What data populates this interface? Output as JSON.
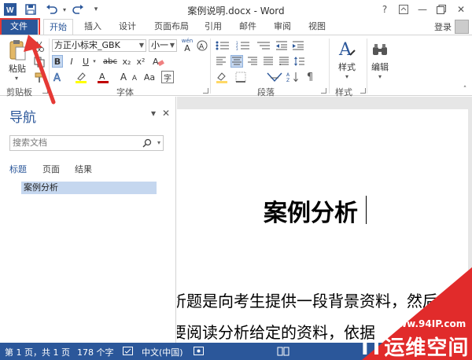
{
  "window": {
    "title": "案例说明.docx - Word",
    "help": "?",
    "minimize": "—",
    "close": "✕"
  },
  "ribbon_tabs": [
    {
      "label": "文件"
    },
    {
      "label": "开始"
    },
    {
      "label": "插入"
    },
    {
      "label": "设计"
    },
    {
      "label": "页面布局"
    },
    {
      "label": "引用"
    },
    {
      "label": "邮件"
    },
    {
      "label": "审阅"
    },
    {
      "label": "视图"
    }
  ],
  "account": {
    "login": "登录"
  },
  "ribbon": {
    "paste": "粘贴",
    "font_name": "方正小标宋_GBK",
    "font_size": "小一",
    "wen": "wén",
    "wen_a": "A",
    "font_btns": {
      "bold": "B",
      "italic": "I",
      "underline": "U",
      "strike": "abc",
      "sub": "x₂",
      "sup": "x²"
    },
    "font_btns2": {
      "grow": "A",
      "shrink": "A",
      "change_case": "Aa",
      "char": "字"
    },
    "style_label": "样式",
    "edit_label": "编辑",
    "groups": {
      "clipboard": "剪贴板",
      "font": "字体",
      "paragraph": "段落",
      "styles": "样式"
    }
  },
  "nav_pane": {
    "title": "导航",
    "collapse": "▾",
    "close": "✕",
    "search_placeholder": "搜索文档",
    "tabs": [
      "标题",
      "页面",
      "结果"
    ],
    "headings": [
      "案例分析"
    ]
  },
  "document": {
    "title": "案例分析",
    "lines": [
      "析题是向考生提供一段背景资料，然后",
      "要阅读分析给定的资料，依据"
    ]
  },
  "statusbar": {
    "page": "第 1 页，共 1 页",
    "words": "178 个字",
    "lang": "中文(中国)"
  },
  "watermark": {
    "url": "www.94IP.com",
    "name": "IT运维空间"
  },
  "colors": {
    "accent": "#2b579a",
    "highlight": "#e53935"
  }
}
